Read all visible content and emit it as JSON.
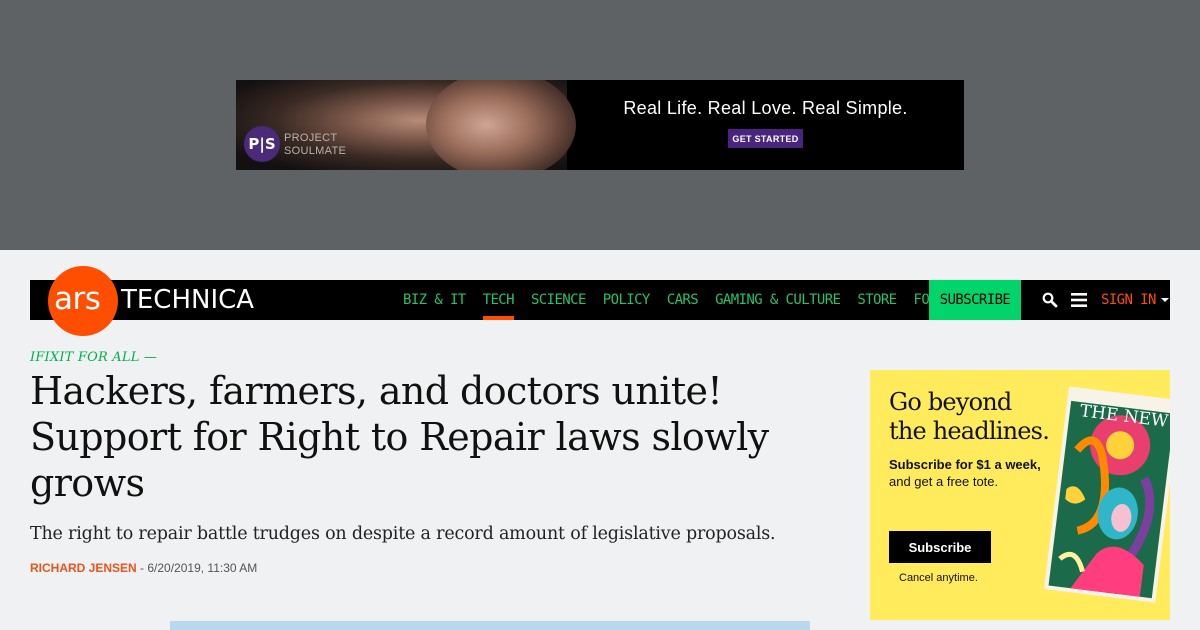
{
  "top_ad": {
    "brand_monogram": "P|S",
    "brand_line1": "PROJECT",
    "brand_line2": "SOULMATE",
    "tagline": "Real Life. Real Love. Real Simple.",
    "cta": "GET STARTED"
  },
  "nav": {
    "logo_ars": "ars",
    "logo_technica": "TECHNICA",
    "links": [
      "BIZ & IT",
      "TECH",
      "SCIENCE",
      "POLICY",
      "CARS",
      "GAMING & CULTURE",
      "STORE",
      "FORUMS"
    ],
    "active_link": "TECH",
    "subscribe": "SUBSCRIBE",
    "sign_in": "SIGN IN",
    "colors": {
      "link": "#27c16b",
      "accent": "#ff4e00",
      "subscribe_bg": "#00d46a"
    }
  },
  "article": {
    "kicker": "IFIXIT FOR ALL —",
    "headline": "Hackers, farmers, and doctors unite! Support for Right to Repair laws slowly grows",
    "dek": "The right to repair battle trudges on despite a record amount of legislative proposals.",
    "author": "RICHARD JENSEN",
    "date": "- 6/20/2019, 11:30 AM"
  },
  "side_ad": {
    "headline_line1": "Go beyond",
    "headline_line2": "the headlines.",
    "offer_bold": "Subscribe for $1 a week,",
    "offer_rest": "and get a free tote.",
    "button": "Subscribe",
    "cancel": "Cancel anytime.",
    "magazine_title": "THE NEW YORKER",
    "bg_color": "#ffeb5c"
  }
}
